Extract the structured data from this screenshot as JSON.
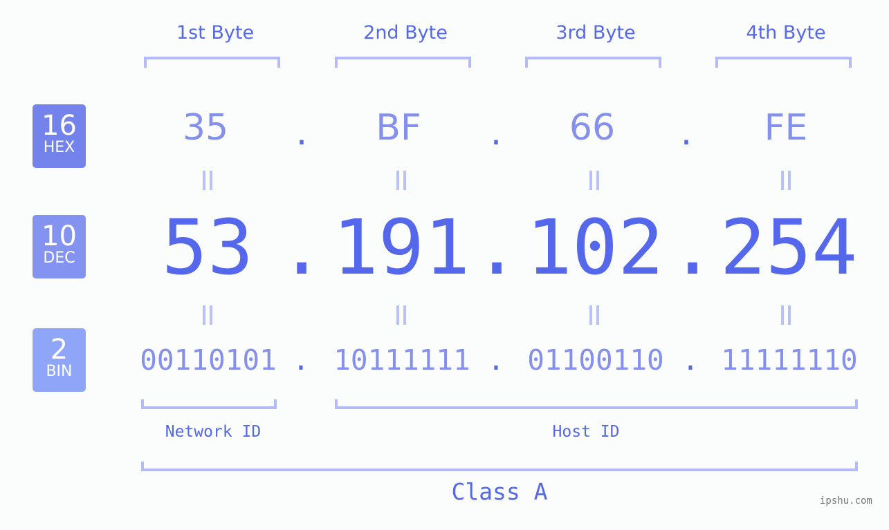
{
  "colors": {
    "accent": "#5568e6",
    "hex_badge": "#7482ec",
    "dec_badge": "#8593f0",
    "bin_badge": "#8fa6f8",
    "bracket": "#b3bcf7",
    "muted_value": "#8590ec"
  },
  "bytes": [
    {
      "label": "1st Byte",
      "hex": "35",
      "dec": "53",
      "bin": "00110101"
    },
    {
      "label": "2nd Byte",
      "hex": "BF",
      "dec": "191",
      "bin": "10111111"
    },
    {
      "label": "3rd Byte",
      "hex": "66",
      "dec": "102",
      "bin": "01100110"
    },
    {
      "label": "4th Byte",
      "hex": "FE",
      "dec": "254",
      "bin": "11111110"
    }
  ],
  "separator": ".",
  "badges": {
    "hex": {
      "number": "16",
      "label": "HEX"
    },
    "dec": {
      "number": "10",
      "label": "DEC"
    },
    "bin": {
      "number": "2",
      "label": "BIN"
    }
  },
  "network_id_label": "Network ID",
  "host_id_label": "Host ID",
  "class_label": "Class A",
  "watermark": "ipshu.com"
}
